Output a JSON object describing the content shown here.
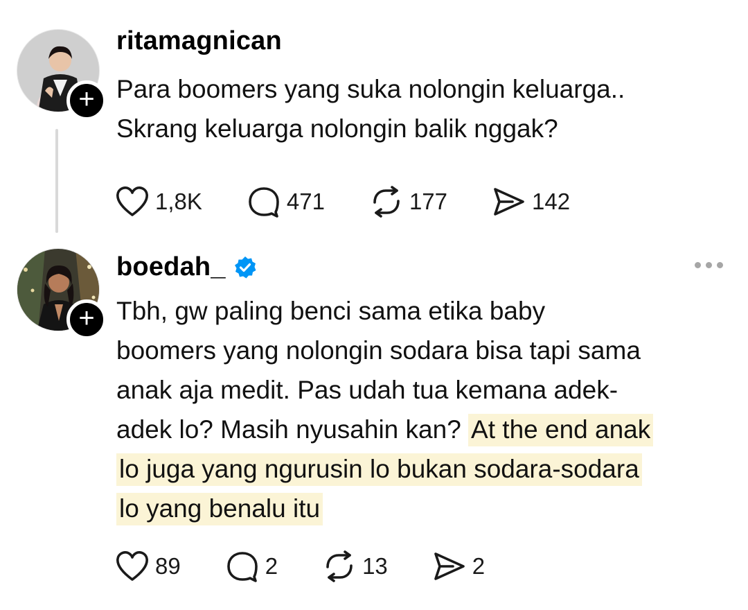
{
  "posts": [
    {
      "username": "ritamagnican",
      "verified": false,
      "lines": [
        "Para boomers yang suka nolongin keluarga..",
        "Skrang keluarga nolongin balik nggak?"
      ],
      "counts": {
        "likes": "1,8K",
        "replies": "471",
        "reposts": "177",
        "shares": "142"
      }
    },
    {
      "username": "boedah_",
      "verified": true,
      "lines": [
        "Tbh, gw paling benci sama etika baby",
        "boomers yang nolongin sodara bisa tapi sama",
        "anak aja medit. Pas udah tua kemana adek-",
        "adek lo? Masih nyusahin kan?"
      ],
      "highlight": [
        "At the end anak",
        "lo juga yang ngurusin lo bukan sodara-sodara",
        "lo yang benalu itu"
      ],
      "counts": {
        "likes": "89",
        "replies": "2",
        "reposts": "13",
        "shares": "2"
      }
    }
  ],
  "follow_symbol": "+",
  "colors": {
    "highlight": "#fbf4d6",
    "verified": "#0095f6",
    "thread_line": "#d9d9d9",
    "badge": "#000000"
  },
  "icons": [
    "heart-icon",
    "comment-icon",
    "repost-icon",
    "share-icon",
    "more-icon",
    "verified-icon",
    "plus-icon"
  ]
}
